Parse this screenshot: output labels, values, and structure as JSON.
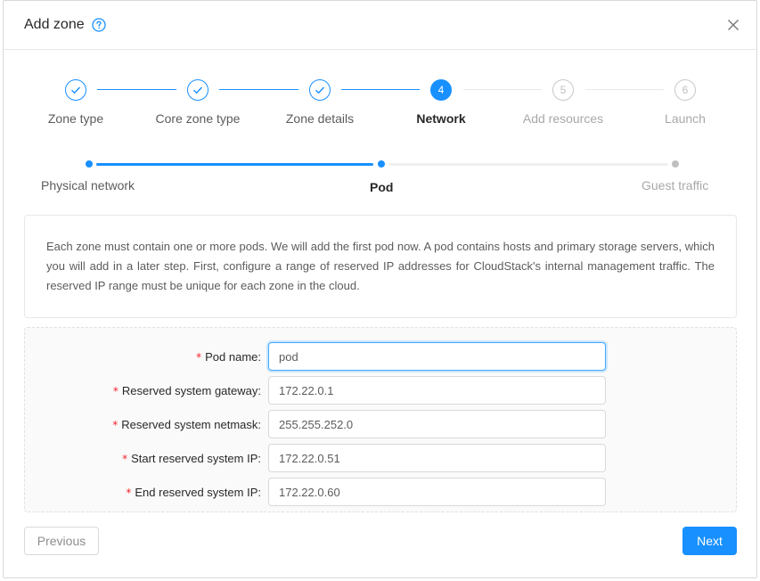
{
  "modal": {
    "title": "Add zone"
  },
  "steps": [
    {
      "number": "1",
      "label": "Zone type",
      "status": "done"
    },
    {
      "number": "2",
      "label": "Core zone type",
      "status": "done"
    },
    {
      "number": "3",
      "label": "Zone details",
      "status": "done"
    },
    {
      "number": "4",
      "label": "Network",
      "status": "active"
    },
    {
      "number": "5",
      "label": "Add resources",
      "status": "wait"
    },
    {
      "number": "6",
      "label": "Launch",
      "status": "wait"
    }
  ],
  "substeps": [
    {
      "label": "Physical network",
      "status": "done"
    },
    {
      "label": "Pod",
      "status": "active"
    },
    {
      "label": "Guest traffic",
      "status": "wait"
    }
  ],
  "description": "Each zone must contain one or more pods. We will add the first pod now. A pod contains hosts and primary storage servers, which you will add in a later step. First, configure a range of reserved IP addresses for CloudStack's internal management traffic. The reserved IP range must be unique for each zone in the cloud.",
  "form": {
    "required_mark": "*",
    "fields": [
      {
        "label": "Pod name:",
        "value": "pod"
      },
      {
        "label": "Reserved system gateway:",
        "value": "172.22.0.1"
      },
      {
        "label": "Reserved system netmask:",
        "value": "255.255.252.0"
      },
      {
        "label": "Start reserved system IP:",
        "value": "172.22.0.51"
      },
      {
        "label": "End reserved system IP:",
        "value": "172.22.0.60"
      }
    ]
  },
  "buttons": {
    "previous": "Previous",
    "next": "Next"
  },
  "colors": {
    "primary": "#1890ff",
    "required": "#f5222d"
  }
}
